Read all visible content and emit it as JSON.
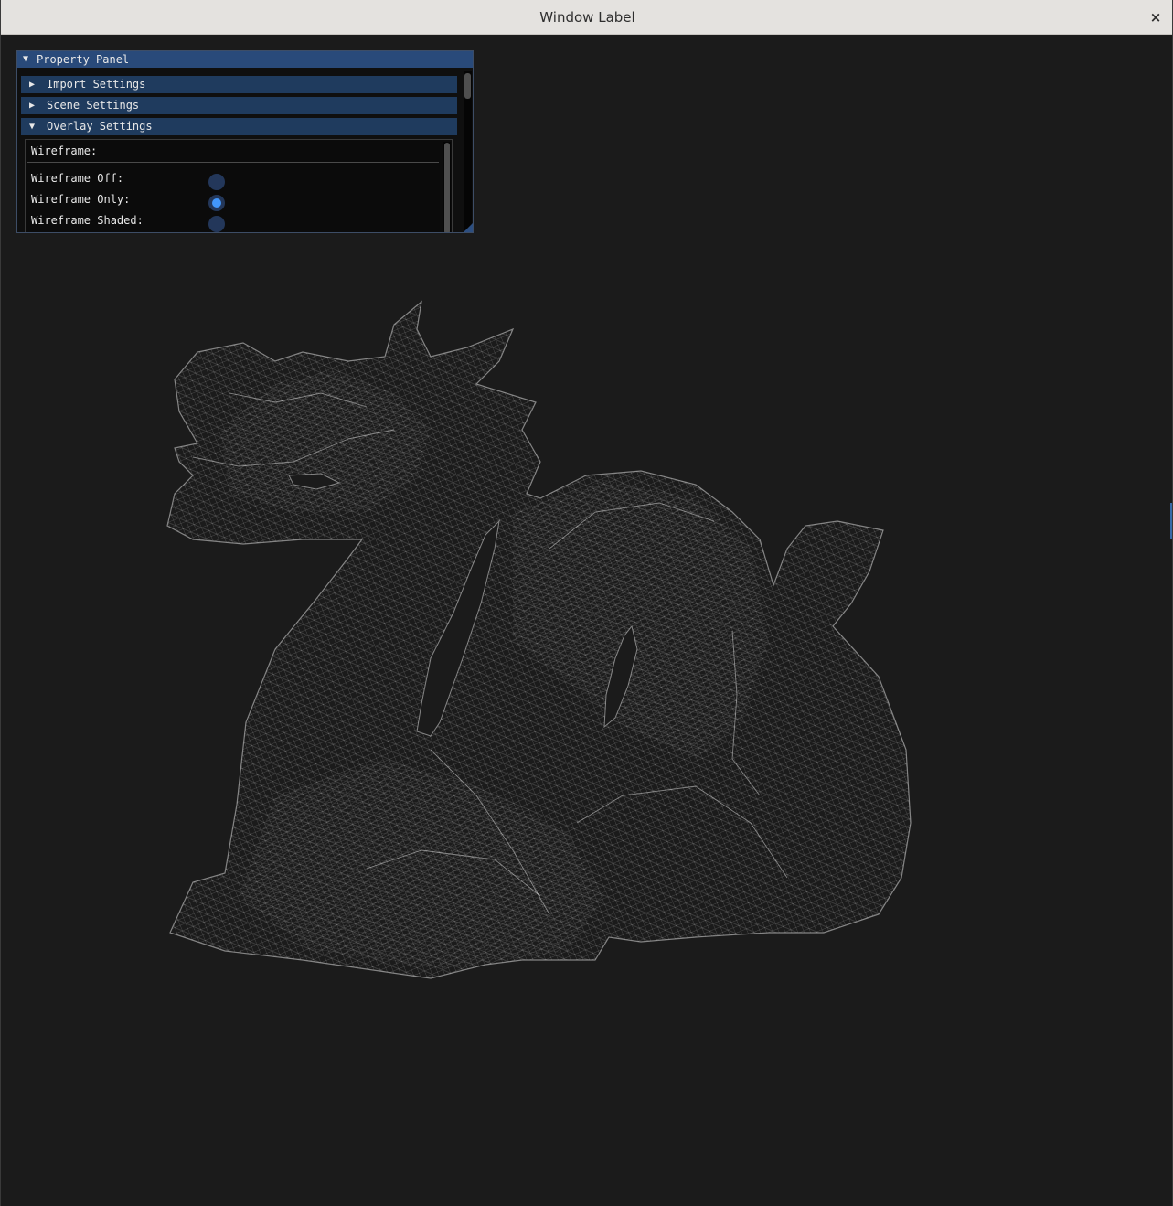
{
  "window": {
    "title": "Window Label",
    "close_glyph": "×"
  },
  "panel": {
    "title": "Property Panel",
    "title_arrow": "▼",
    "sections": [
      {
        "label": "Import Settings",
        "arrow": "▶",
        "expanded": false
      },
      {
        "label": "Scene Settings",
        "arrow": "▶",
        "expanded": false
      },
      {
        "label": "Overlay Settings",
        "arrow": "▼",
        "expanded": true
      }
    ],
    "overlay": {
      "heading": "Wireframe:",
      "options": [
        {
          "label": "Wireframe Off:",
          "selected": false
        },
        {
          "label": "Wireframe Only:",
          "selected": true
        },
        {
          "label": "Wireframe Shaded:",
          "selected": false
        }
      ]
    }
  },
  "colors": {
    "background": "#1b1b1b",
    "panel_title": "#294a7a",
    "header": "#1f3b5e",
    "radio_active": "#4296fa",
    "wireframe": "#d9d9d9"
  },
  "viewport": {
    "model": "dragon wireframe mesh",
    "render_mode": "Wireframe Only"
  }
}
